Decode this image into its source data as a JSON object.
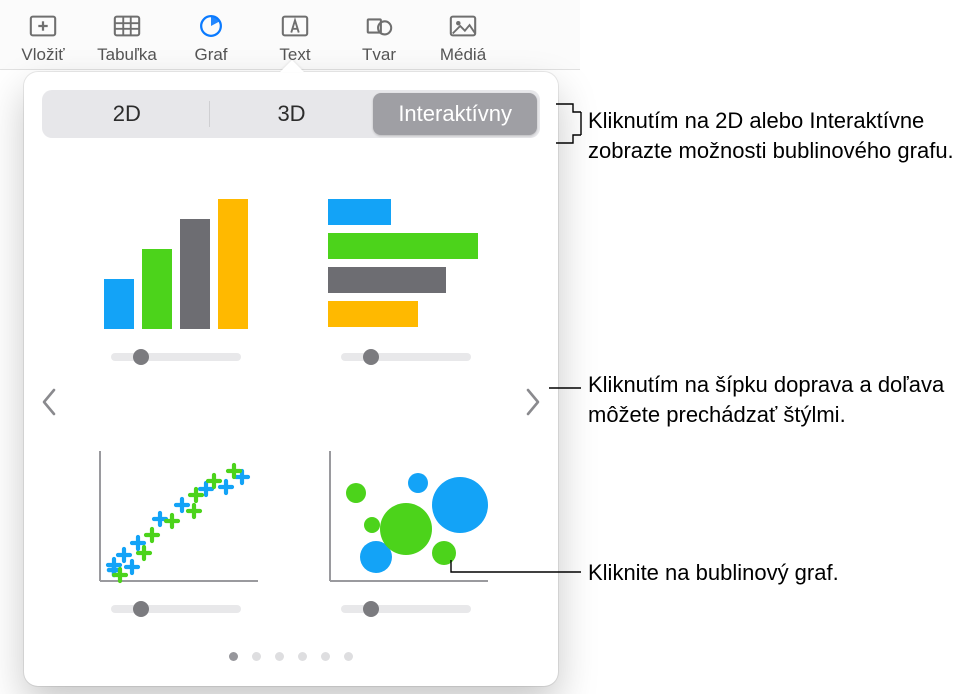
{
  "toolbar": {
    "items": [
      {
        "label": "Vložiť",
        "name": "insert"
      },
      {
        "label": "Tabuľka",
        "name": "table"
      },
      {
        "label": "Graf",
        "name": "chart",
        "active": true
      },
      {
        "label": "Text",
        "name": "text"
      },
      {
        "label": "Tvar",
        "name": "shape"
      },
      {
        "label": "Médiá",
        "name": "media"
      }
    ]
  },
  "popover": {
    "tabs": {
      "t0": "2D",
      "t1": "3D",
      "t2": "Interaktívny"
    },
    "thumbs": {
      "bar_column": "column-chart",
      "bar_horizontal": "bar-chart",
      "scatter": "scatter-chart",
      "bubble": "bubble-chart"
    }
  },
  "callouts": {
    "c1": "Kliknutím na 2D alebo Interaktívne zobrazte možnosti bublinového grafu.",
    "c2": "Kliknutím na šípku doprava a doľava môžete prechádzať štýlmi.",
    "c3": "Kliknite na bublinový graf."
  },
  "colors": {
    "blue": "#13a3f7",
    "green": "#4cd31b",
    "gray": "#6d6d72",
    "yellow": "#ffb900"
  }
}
